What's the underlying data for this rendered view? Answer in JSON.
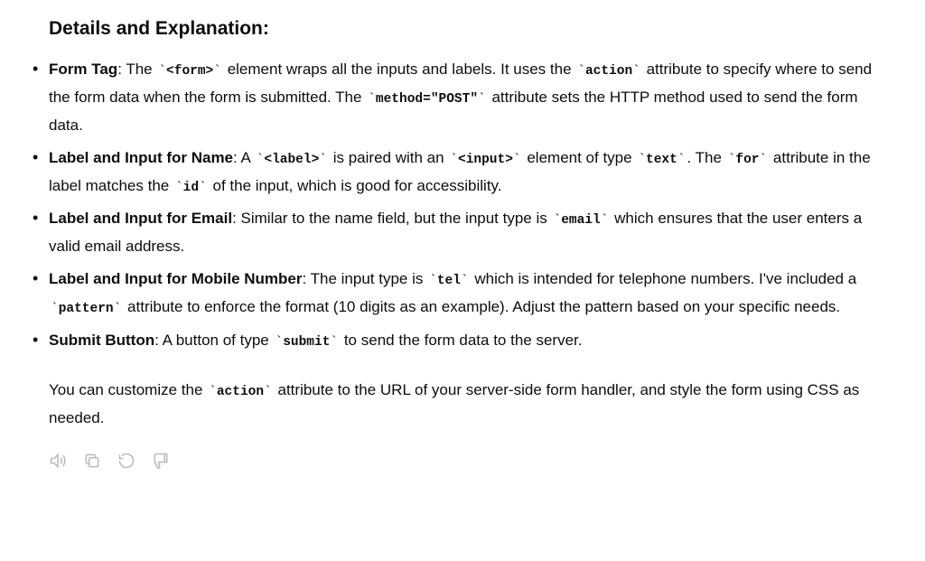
{
  "heading": "Details and Explanation:",
  "items": [
    {
      "title": "Form Tag",
      "pre": ": The ",
      "code1": "<form>",
      "mid1": " element wraps all the inputs and labels. It uses the ",
      "code2": "action",
      "mid2": " attribute to specify where to send the form data when the form is submitted. The ",
      "code3": "method=\"POST\"",
      "post": " attribute sets the HTTP method used to send the form data."
    },
    {
      "title": "Label and Input for Name",
      "pre": ": A ",
      "code1": "<label>",
      "mid1": " is paired with an ",
      "code2": "<input>",
      "mid2": " element of type ",
      "code3": "text",
      "mid3": ". The ",
      "code4": "for",
      "mid4": " attribute in the label matches the ",
      "code5": "id",
      "post": " of the input, which is good for accessibility."
    },
    {
      "title": "Label and Input for Email",
      "pre": ": Similar to the name field, but the input type is ",
      "code1": "email",
      "post": " which ensures that the user enters a valid email address."
    },
    {
      "title": "Label and Input for Mobile Number",
      "pre": ": The input type is ",
      "code1": "tel",
      "mid1": " which is intended for telephone numbers. I've included a ",
      "code2": "pattern",
      "post": " attribute to enforce the format (10 digits as an example). Adjust the pattern based on your specific needs."
    },
    {
      "title": "Submit Button",
      "pre": ": A button of type ",
      "code1": "submit",
      "post": " to send the form data to the server."
    }
  ],
  "closing": {
    "t1": "You can customize the ",
    "c1": "action",
    "t2": " attribute to the URL of your server-side form handler, and style the form using CSS as needed."
  }
}
